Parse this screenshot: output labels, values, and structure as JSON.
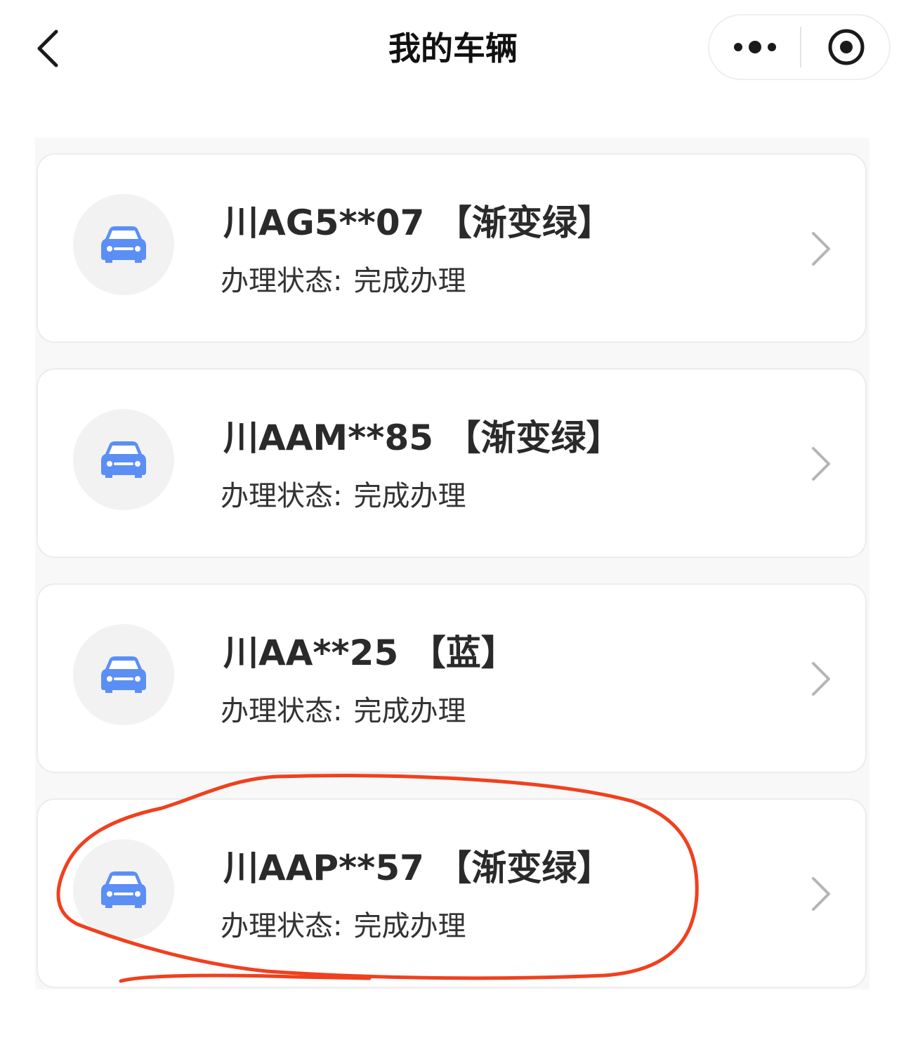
{
  "navbar": {
    "title": "我的车辆",
    "back_icon": "chevron-left-icon",
    "more_icon": "more-dots-icon",
    "close_icon": "target-circle-icon"
  },
  "vehicles": [
    {
      "plate": "川AG5**07",
      "color_tag": "【渐变绿】",
      "status_label": "办理状态:",
      "status_value": "完成办理"
    },
    {
      "plate": "川AAM**85",
      "color_tag": "【渐变绿】",
      "status_label": "办理状态:",
      "status_value": "完成办理"
    },
    {
      "plate": "川AA**25",
      "color_tag": "【蓝】",
      "status_label": "办理状态:",
      "status_value": "完成办理"
    },
    {
      "plate": "川AAP**57",
      "color_tag": "【渐变绿】",
      "status_label": "办理状态:",
      "status_value": "完成办理"
    }
  ],
  "colors": {
    "car_icon": "#5b8ff5",
    "avatar_bg": "#f2f2f2",
    "annotation_stroke": "#f0401e"
  }
}
